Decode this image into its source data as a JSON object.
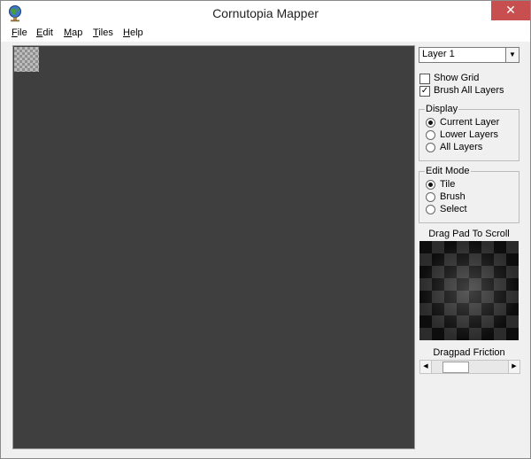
{
  "window": {
    "title": "Cornutopia Mapper",
    "close_label": "✕"
  },
  "menu": [
    {
      "key": "F",
      "rest": "ile"
    },
    {
      "key": "E",
      "rest": "dit"
    },
    {
      "key": "M",
      "rest": "ap"
    },
    {
      "key": "T",
      "rest": "iles"
    },
    {
      "key": "H",
      "rest": "elp"
    }
  ],
  "panel": {
    "layer_select": {
      "value": "Layer 1",
      "arrow": "▼"
    },
    "show_grid": {
      "label": "Show Grid",
      "checked": false
    },
    "brush_all_layers": {
      "label": "Brush All Layers",
      "checked": true,
      "mark": "✓"
    },
    "display": {
      "legend": "Display",
      "options": [
        "Current Layer",
        "Lower Layers",
        "All Layers"
      ],
      "selected": "Current Layer"
    },
    "edit_mode": {
      "legend": "Edit Mode",
      "options": [
        "Tile",
        "Brush",
        "Select"
      ],
      "selected": "Tile"
    },
    "dragpad_caption": "Drag Pad To Scroll",
    "friction_caption": "Dragpad Friction",
    "friction": {
      "fraction": 0.22,
      "left_arrow": "◀",
      "right_arrow": "▶"
    }
  },
  "icons": {
    "app": "globe-icon",
    "close": "close-icon"
  }
}
